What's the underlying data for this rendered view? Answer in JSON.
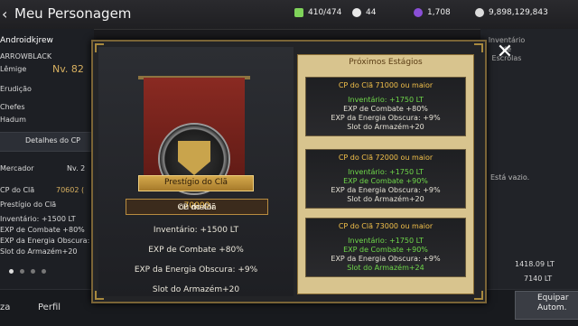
{
  "header": {
    "title": "Meu Personagem",
    "resources": [
      {
        "icon": "energy-icon",
        "value": "410/474",
        "color": "#7fd35a"
      },
      {
        "icon": "pearl-icon",
        "value": "44",
        "color": "#e8e8e8"
      },
      {
        "icon": "dark-gem-icon",
        "value": "1,708",
        "color": "#8a4fd6"
      },
      {
        "icon": "silver-icon",
        "value": "9,898,129,843",
        "color": "#dcdcdc"
      }
    ]
  },
  "character": {
    "name": "Androidkjrew",
    "guild": "ARROWBLACK",
    "class_label": "Lêmige",
    "level": "Nv. 82",
    "rows": [
      "Erudição",
      "Chefes",
      "Hadum"
    ],
    "cp_details_label": "Detalhes do CP",
    "merchant_label": "Mercador",
    "merchant_level": "Nv. 2",
    "clan_cp_label": "CP do Clã",
    "clan_cp_value": "70602 (",
    "prestige_label": "Prestígio do Clã",
    "bonuses": [
      "Inventário: +1500 LT",
      "EXP de Combate +80%",
      "EXP da Energia Obscura:",
      "Slot do Armazém+20"
    ]
  },
  "bottom_tabs": [
    "za",
    "Perfil"
  ],
  "right_panel": {
    "inventory_tab": "Inventário de Escrolas",
    "empty_text": "Está vazio.",
    "weight": "1418.09 LT",
    "capacity": "7140 LT",
    "equip_button": "Equipar Autom."
  },
  "modal": {
    "prestige_title": "Prestígio do Clã",
    "requirement_prefix": "CP do Clã ",
    "requirement_value": "70000",
    "requirement_suffix": " ou maior",
    "current_bonuses": [
      "Inventário: +1500 LT",
      "EXP de Combate +80%",
      "EXP da Energia Obscura: +9%",
      "Slot do Armazém+20"
    ],
    "next_title": "Próximos Estágios",
    "stages": [
      {
        "header": "CP do Clã 71000 ou maior",
        "lines": [
          {
            "text": "Inventário: +1750 LT",
            "color": "#6fd84a"
          },
          {
            "text": "EXP de Combate +80%",
            "color": "#e6e2d6"
          },
          {
            "text": "EXP da Energia Obscura: +9%",
            "color": "#e6e2d6"
          },
          {
            "text": "Slot do Armazém+20",
            "color": "#e6e2d6"
          }
        ]
      },
      {
        "header": "CP do Clã 72000 ou maior",
        "lines": [
          {
            "text": "Inventário: +1750 LT",
            "color": "#6fd84a"
          },
          {
            "text": "EXP de Combate +90%",
            "color": "#6fd84a"
          },
          {
            "text": "EXP da Energia Obscura: +9%",
            "color": "#e6e2d6"
          },
          {
            "text": "Slot do Armazém+20",
            "color": "#e6e2d6"
          }
        ]
      },
      {
        "header": "CP do Clã 73000 ou maior",
        "lines": [
          {
            "text": "Inventário: +1750 LT",
            "color": "#6fd84a"
          },
          {
            "text": "EXP de Combate +90%",
            "color": "#6fd84a"
          },
          {
            "text": "EXP da Energia Obscura: +9%",
            "color": "#e6e2d6"
          },
          {
            "text": "Slot do Armazém+24",
            "color": "#6fd84a"
          }
        ]
      }
    ],
    "close_icon": "close-icon"
  }
}
